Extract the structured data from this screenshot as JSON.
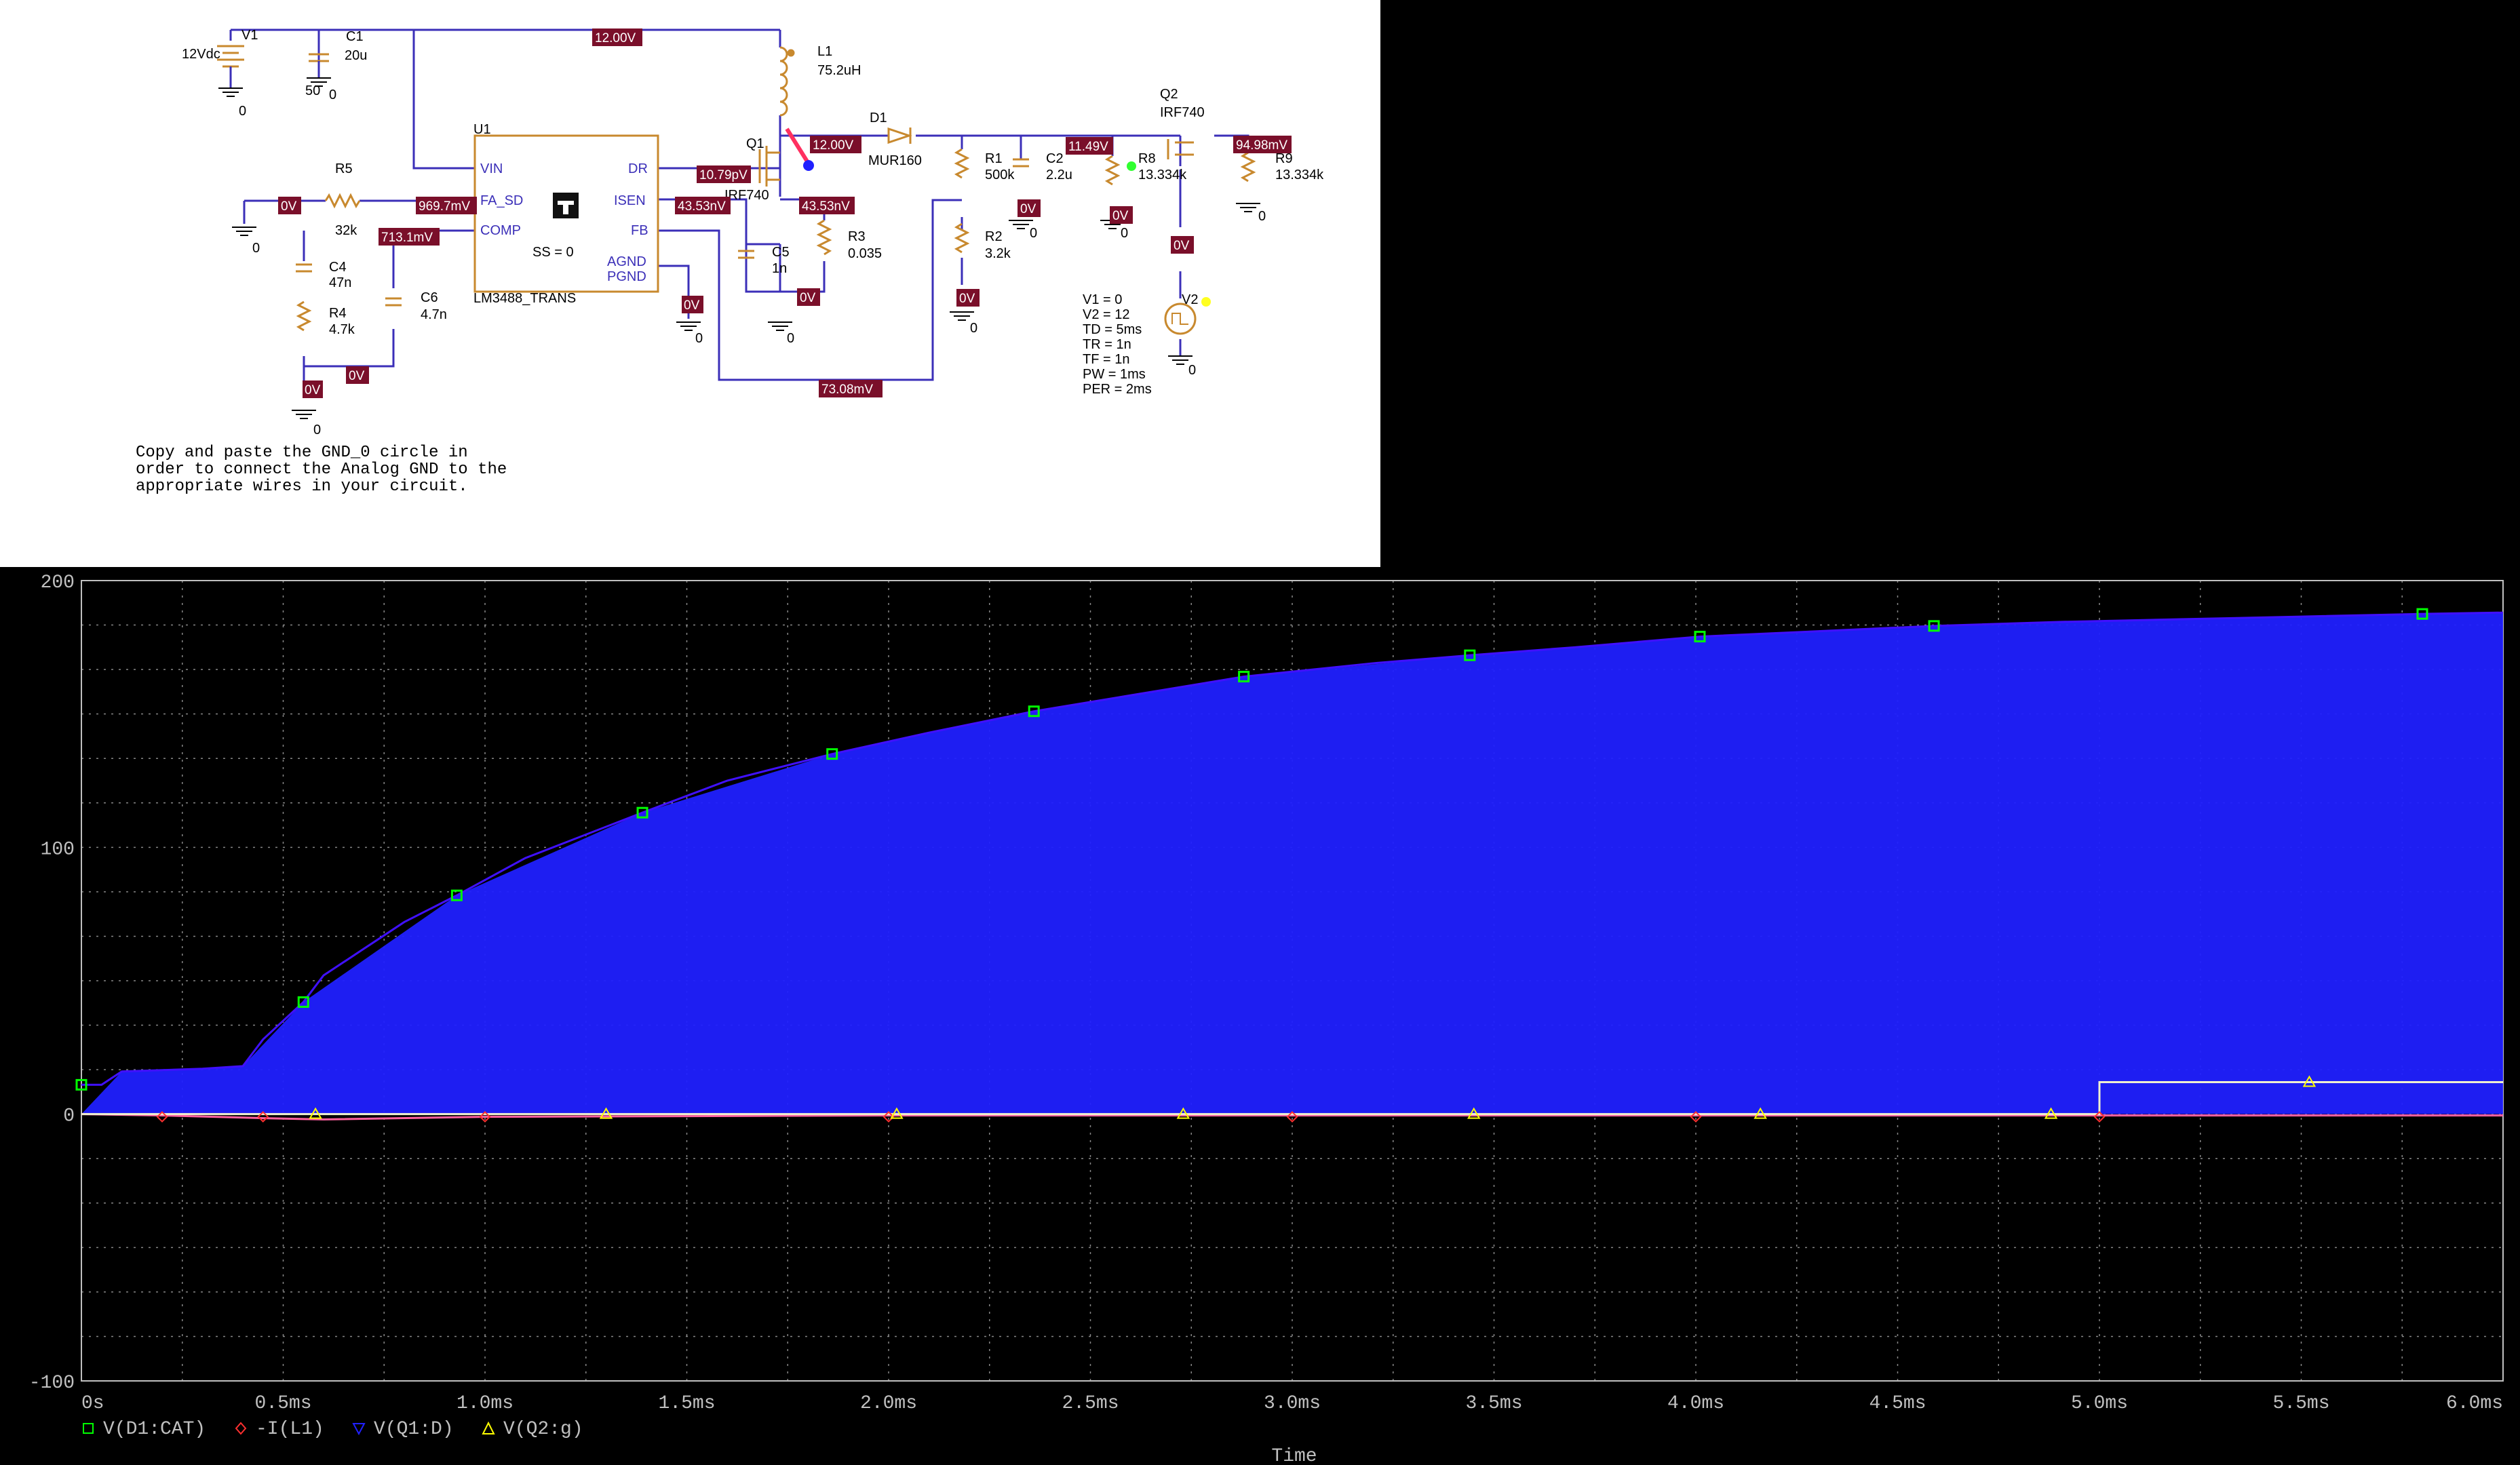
{
  "schematic": {
    "components": {
      "v1": {
        "ref": "V1",
        "value": "12Vdc"
      },
      "c1": {
        "ref": "C1",
        "value": "20u"
      },
      "l1": {
        "ref": "L1",
        "value": "75.2uH"
      },
      "d1": {
        "ref": "D1",
        "value": "MUR160"
      },
      "q1": {
        "ref": "Q1",
        "value": "IRF740"
      },
      "q2": {
        "ref": "Q2",
        "value": "IRF740"
      },
      "u1": {
        "ref": "U1",
        "value": "LM3488_TRANS",
        "ss": "SS = 0",
        "pins": {
          "vin": "VIN",
          "fa_sd": "FA_SD",
          "comp": "COMP",
          "dr": "DR",
          "isen": "ISEN",
          "fb": "FB",
          "agnd": "AGND",
          "pgnd": "PGND"
        }
      },
      "r5": {
        "ref": "R5",
        "value": "32k"
      },
      "c4": {
        "ref": "C4",
        "value": "47n"
      },
      "r4": {
        "ref": "R4",
        "value": "4.7k"
      },
      "c6": {
        "ref": "C6",
        "value": "4.7n"
      },
      "c5": {
        "ref": "C5",
        "value": "1n"
      },
      "r3": {
        "ref": "R3",
        "value": "0.035"
      },
      "r1": {
        "ref": "R1",
        "value": "500k"
      },
      "c2": {
        "ref": "C2",
        "value": "2.2u"
      },
      "r2": {
        "ref": "R2",
        "value": "3.2k"
      },
      "r8": {
        "ref": "R8",
        "value": "13.334k"
      },
      "r9": {
        "ref": "R9",
        "value": "13.334k"
      },
      "v2": {
        "ref": "V2",
        "params": [
          "V1 = 0",
          "V2 = 12",
          "TD = 5ms",
          "TR = 1n",
          "TF = 1n",
          "PW = 1ms",
          "PER = 2ms"
        ]
      },
      "c1_gnd_label": "50",
      "ground_label": "0"
    },
    "voltage_markers": {
      "vin_top": "12.00V",
      "q1_drain": "12.00V",
      "dr_net": "10.79pV",
      "isen_left": "43.53nV",
      "isen_right": "43.53nV",
      "fa_sd": "969.7mV",
      "comp": "713.1mV",
      "r5_left": "0V",
      "c4_bottom": "0V",
      "c6_bottom": "0V",
      "c5_gnd": "0V",
      "pgnd": "0V",
      "r2_gnd": "0V",
      "c2_gnd": "0V",
      "r8_gnd": "0V",
      "out_node": "11.49V",
      "q2_out": "94.98mV",
      "q2_gate": "0V",
      "fb_net": "73.08mV"
    },
    "note": "Copy and paste the GND_0 circle in\norder to connect the Analog GND to the\nappropriate wires in your circuit."
  },
  "probe": {
    "background": "#000000",
    "grid_color": "#c0c0c0",
    "y_ticks": [
      "200",
      "100",
      "0",
      "-100"
    ],
    "x_ticks": [
      "0s",
      "0.5ms",
      "1.0ms",
      "1.5ms",
      "2.0ms",
      "2.5ms",
      "3.0ms",
      "3.5ms",
      "4.0ms",
      "4.5ms",
      "5.0ms",
      "5.5ms",
      "6.0ms"
    ],
    "x_axis_label": "Time",
    "legend": [
      {
        "label": "V(D1:CAT)",
        "color": "#00ff00",
        "marker": "square"
      },
      {
        "label": "-I(L1)",
        "color": "#ff3030",
        "marker": "diamond"
      },
      {
        "label": "V(Q1:D)",
        "color": "#2020ff",
        "marker": "triangle-down"
      },
      {
        "label": "V(Q2:g)",
        "color": "#ffff00",
        "marker": "triangle-up"
      }
    ]
  },
  "chart_data": {
    "type": "line",
    "xlabel": "Time",
    "ylabel": "",
    "xlim_ms": [
      0,
      6.0
    ],
    "ylim": [
      -100,
      200
    ],
    "grid": true,
    "legend_position": "bottom-left",
    "series": [
      {
        "name": "V(D1:CAT)",
        "color": "#00ff00",
        "x_ms": [
          0,
          0.05,
          0.1,
          0.3,
          0.4,
          0.45,
          0.55,
          0.6,
          0.7,
          0.8,
          0.93,
          1.1,
          1.39,
          1.6,
          1.86,
          2.1,
          2.36,
          2.6,
          2.88,
          3.2,
          3.44,
          3.7,
          4.01,
          4.3,
          4.59,
          4.9,
          5.2,
          5.5,
          5.8,
          6.0
        ],
        "values": [
          11,
          11,
          16,
          17,
          18,
          28,
          42,
          52,
          62,
          72,
          82,
          96,
          113,
          125,
          135,
          143,
          151,
          157,
          164,
          169,
          172,
          175,
          179,
          181,
          183,
          184.5,
          185.5,
          186.5,
          187.5,
          188
        ]
      },
      {
        "name": "V(Q1:D)",
        "color": "#2020ff",
        "band": "switching between 0 and V(D1:CAT)",
        "x_ms": [
          0,
          0.1,
          0.3,
          0.4,
          0.55,
          0.93,
          1.39,
          1.86,
          2.36,
          2.88,
          3.44,
          4.01,
          4.59,
          5.2,
          5.8,
          6.0
        ],
        "values": [
          0,
          16,
          17,
          18,
          42,
          82,
          113,
          135,
          151,
          164,
          172,
          179,
          183,
          185.5,
          187.5,
          188
        ]
      },
      {
        "name": "-I(L1)",
        "color": "#ff3030",
        "x_ms": [
          0,
          0.2,
          0.45,
          0.6,
          1.0,
          2.0,
          3.0,
          4.0,
          5.0,
          6.0
        ],
        "values": [
          0,
          -0.5,
          -1.5,
          -2,
          -1,
          -0.5,
          -0.5,
          -0.5,
          -0.5,
          -0.5
        ]
      },
      {
        "name": "V(Q2:g)",
        "color": "#ffff00",
        "x_ms": [
          0,
          5.0,
          5.0,
          6.0
        ],
        "values": [
          0,
          0,
          12,
          12
        ]
      }
    ]
  }
}
